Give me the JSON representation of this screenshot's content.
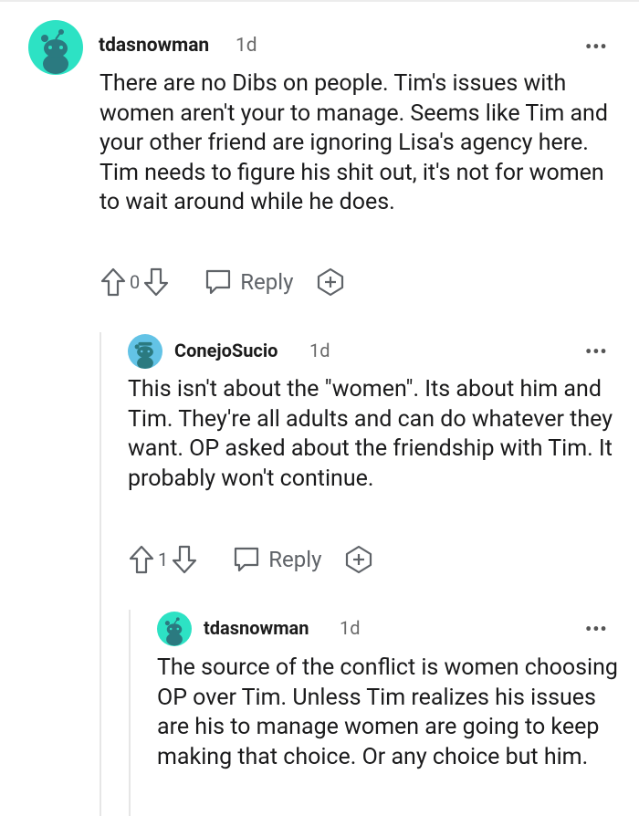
{
  "comments": [
    {
      "username": "tdasnowman",
      "age": "1d",
      "body": "There are no Dibs on people. Tim's issues with women aren't your to manage. Seems like Tim and your other friend are ignoring Lisa's agency here. Tim needs to figure his shit out, it's not for women to wait around while he does.",
      "score": "0",
      "reply_label": "Reply",
      "more": "•••"
    },
    {
      "username": "ConejoSucio",
      "age": "1d",
      "body": "This isn't about the \"women\". Its about him and Tim. They're all adults and can do whatever they want. OP asked about the friendship with Tim. It probably won't continue.",
      "score": "1",
      "reply_label": "Reply",
      "more": "•••"
    },
    {
      "username": "tdasnowman",
      "age": "1d",
      "body": "The source of the conflict is women choosing OP over Tim. Unless Tim realizes his issues are his to manage women are going to keep making that choice. Or any choice but him.",
      "more": "•••"
    }
  ],
  "colors": {
    "avatar_bg": "#2de2c4",
    "avatar_figure": "#2b7a80"
  }
}
